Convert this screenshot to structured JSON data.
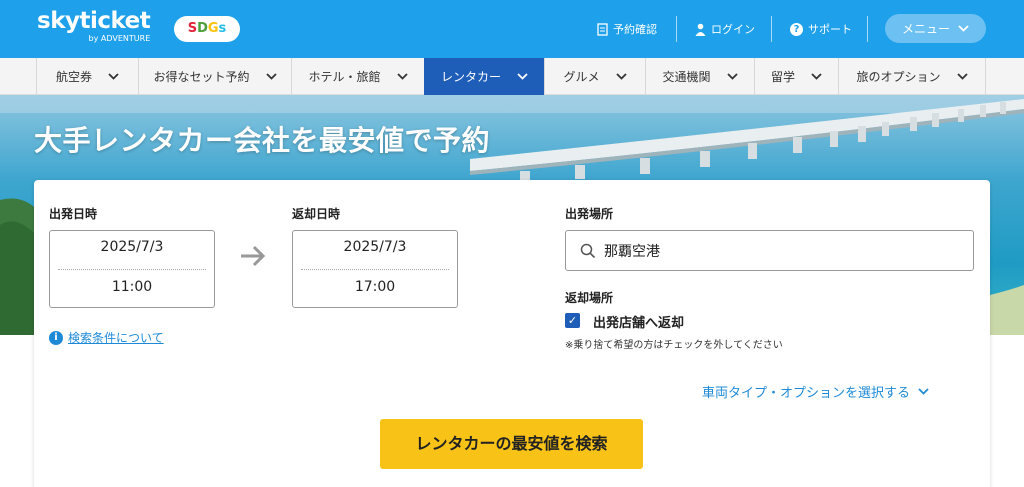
{
  "header": {
    "logo": "skyticket",
    "logo_sub": "by ADVENTURE",
    "sdgs": "SDGs",
    "links": [
      "予約確認",
      "ログイン",
      "サポート"
    ],
    "menu": "メニュー"
  },
  "nav": {
    "items": [
      {
        "label": "航空券"
      },
      {
        "label": "お得なセット予約"
      },
      {
        "label": "ホテル・旅館"
      },
      {
        "label": "レンタカー"
      },
      {
        "label": "グルメ"
      },
      {
        "label": "交通機関"
      },
      {
        "label": "留学"
      },
      {
        "label": "旅のオプション"
      }
    ],
    "active": "レンタカー"
  },
  "hero": {
    "title": "大手レンタカー会社を最安値で予約"
  },
  "search": {
    "depart_label": "出発日時",
    "depart_date": "2025/7/3",
    "depart_time": "11:00",
    "return_label": "返却日時",
    "return_date": "2025/7/3",
    "return_time": "17:00",
    "place_label": "出発場所",
    "place_value": "那覇空港",
    "return_place_label": "返却場所",
    "return_same_label": "出発店舗へ返却",
    "return_same_checked": true,
    "note": "※乗り捨て希望の方はチェックを外してください",
    "conditions_link": "検索条件について",
    "options_link": "車両タイプ・オプションを選択する",
    "submit": "レンタカーの最安値を検索"
  },
  "colors": {
    "header": "#1ea0eb",
    "nav_active": "#1e5db8",
    "button": "#f8c217",
    "link": "#1e8ad6"
  }
}
